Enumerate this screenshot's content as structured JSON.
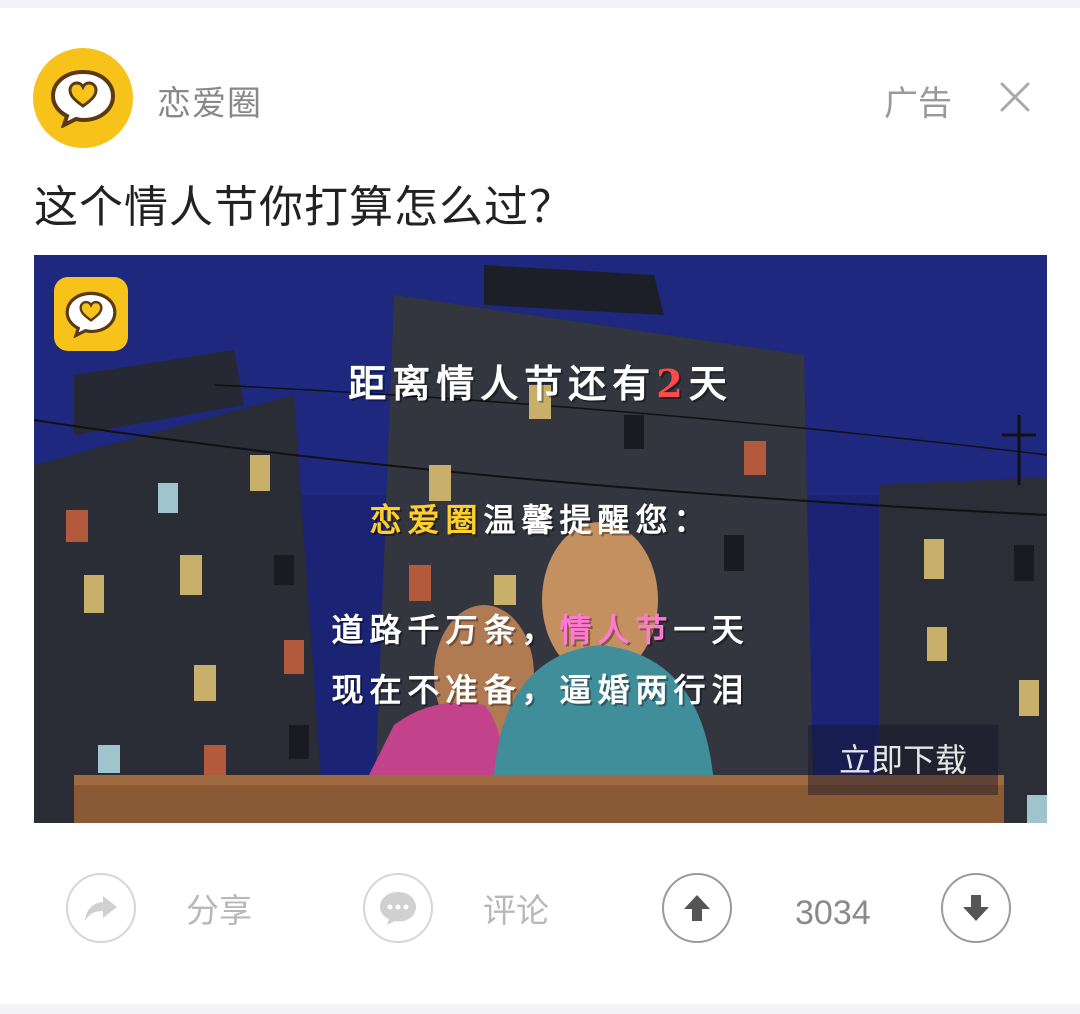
{
  "header": {
    "brand_name": "恋爱圈",
    "ad_label": "广告",
    "close_icon": "close-icon",
    "avatar_icon": "heart-chat-bubble-icon"
  },
  "post": {
    "headline": "这个情人节你打算怎么过？"
  },
  "banner": {
    "line1_pre": "距离情人节还有",
    "line1_num": "2",
    "line1_post": "天",
    "line2_brand": "恋爱圈",
    "line2_rest": "温馨提醒您：",
    "line3_pre": "道路千万条，",
    "line3_hl": "情人节",
    "line3_post": "一天",
    "line4": "现在不准备，逼婚两行泪",
    "download_label": "立即下载",
    "colors": {
      "sky": "#1b2374",
      "highlight_red": "#ff4a4a",
      "highlight_yellow": "#ffcf2e",
      "highlight_pink": "#ff7ad0"
    }
  },
  "actions": {
    "share_label": "分享",
    "comment_label": "评论",
    "upvote_count": "3034",
    "icons": [
      "share-arrow-icon",
      "comment-bubble-icon",
      "upvote-arrow-icon",
      "downvote-arrow-icon"
    ]
  },
  "colors": {
    "brand_yellow": "#f7c21a"
  }
}
